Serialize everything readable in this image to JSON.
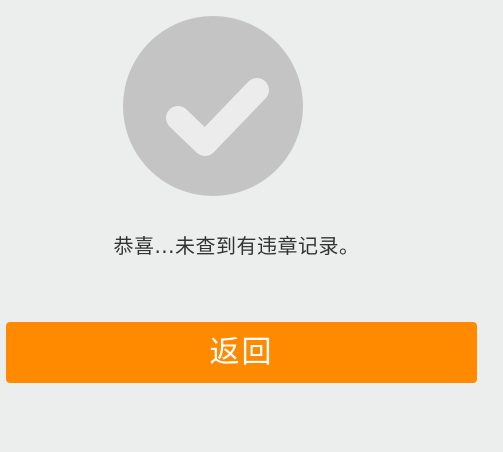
{
  "result": {
    "icon": "checkmark-icon",
    "message": "恭喜...未查到有违章记录。",
    "icon_circle_color": "#c4c4c4",
    "icon_check_color": "#ececec"
  },
  "actions": {
    "back_label": "返回",
    "back_color": "#ff8a00"
  }
}
